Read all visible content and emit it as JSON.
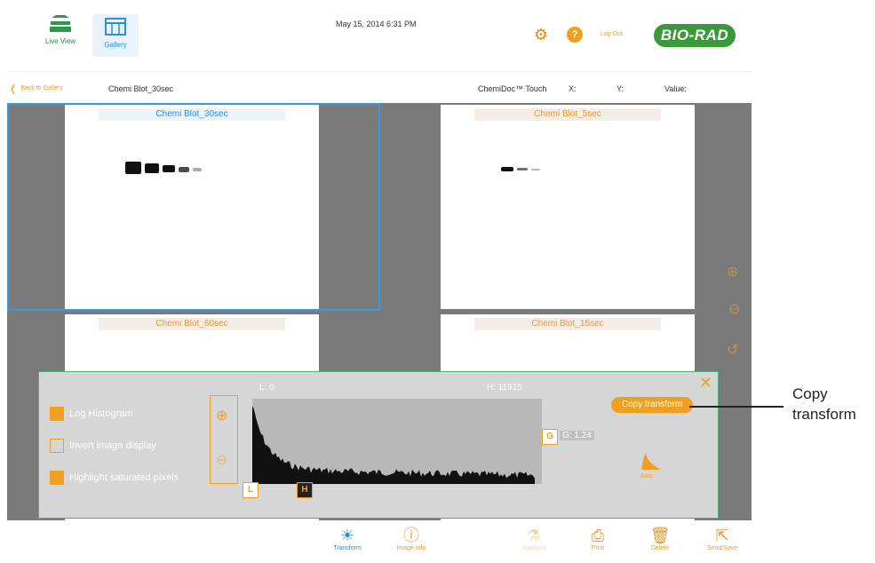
{
  "topbar": {
    "live_view_label": "Live View",
    "gallery_label": "Gallery",
    "datetime": "May 15, 2014 6:31 PM",
    "logout_label": "Log Out",
    "logo_text": "BIO-RAD"
  },
  "subbar": {
    "back_label": "Back to Gallery",
    "filename": "Chemi Blot_30sec",
    "device": "ChemiDoc™ Touch",
    "x_label": "X:",
    "y_label": "Y:",
    "value_label": "Value:"
  },
  "tiles": [
    {
      "title": "Chemi Blot_30sec",
      "selected": true
    },
    {
      "title": "Chemi Blot_5sec",
      "selected": false
    },
    {
      "title": "Chemi Blot_60sec",
      "selected": false
    },
    {
      "title": "Chemi Blot_15sec",
      "selected": false
    }
  ],
  "transform_panel": {
    "options": [
      {
        "label": "Log Histogram",
        "checked": true
      },
      {
        "label": "Invert image display",
        "checked": false
      },
      {
        "label": "Highlight saturated pixels",
        "checked": true
      }
    ],
    "low_label": "L: 0",
    "high_label": "H: 11915",
    "gamma_label": "G: 1.24",
    "marker_l": "L",
    "marker_h": "H",
    "marker_g": "G",
    "copy_button": "Copy transform",
    "auto_label": "Auto"
  },
  "bottombar": {
    "items": [
      {
        "label": "Transform",
        "icon": "sun-icon",
        "active": true
      },
      {
        "label": "Image Info",
        "icon": "info-icon",
        "active": false
      },
      {
        "label": "Analysis",
        "icon": "flask-icon",
        "active": false,
        "disabled": true
      },
      {
        "label": "Print",
        "icon": "printer-icon",
        "active": false
      },
      {
        "label": "Delete",
        "icon": "trash-icon",
        "active": false
      },
      {
        "label": "Send/Save",
        "icon": "share-icon",
        "active": false
      }
    ]
  },
  "callout": {
    "line1": "Copy",
    "line2": "transform"
  },
  "colors": {
    "accent": "#f0a020",
    "select": "#3a9ae0",
    "brand": "#3a9a3a",
    "panel_border": "#4ab07a"
  }
}
